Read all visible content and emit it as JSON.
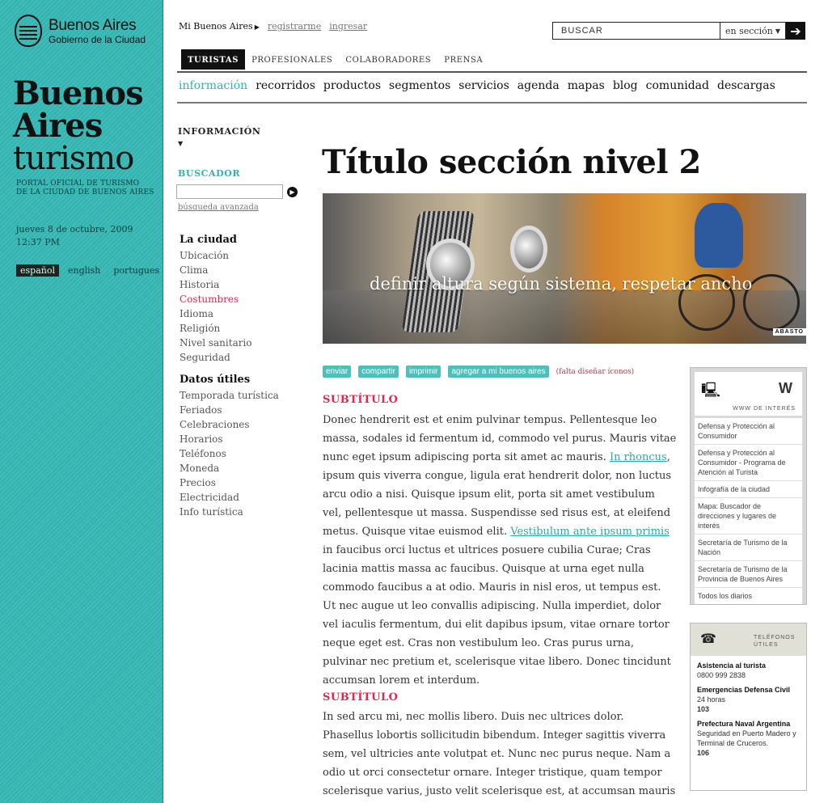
{
  "brand": {
    "logo_line1": "Buenos Aires",
    "logo_line2": "Gobierno de la Ciudad",
    "title_line1": "Buenos",
    "title_line2": "Aires",
    "title_line3": "turismo",
    "portal_line1": "PORTAL OFICIAL DE TURISMO",
    "portal_line2": "DE LA CIUDAD DE BUENOS AIRES",
    "date": "jueves 8 de octubre, 2009",
    "time": "12:37 PM",
    "accent_color": "#35b8b5"
  },
  "languages": [
    {
      "label": "español",
      "active": true
    },
    {
      "label": "english",
      "active": false
    },
    {
      "label": "portugues",
      "active": false
    }
  ],
  "topnav": {
    "mi": "Mi Buenos Aires",
    "register": "registrarme",
    "login": "ingresar"
  },
  "search": {
    "placeholder": "BUSCAR",
    "scope": "en sección",
    "go_icon": "arrow-right-icon"
  },
  "tabs": [
    "TURISTAS",
    "PROFESIONALES",
    "COLABORADORES",
    "PRENSA"
  ],
  "subnav": [
    "información",
    "recorridos",
    "productos",
    "segmentos",
    "servicios",
    "agenda",
    "mapas",
    "blog",
    "comunidad",
    "descargas"
  ],
  "sidebar": {
    "section": "INFORMACIÓN",
    "buscador_title": "BUSCADOR",
    "advanced": "búsqueda avanzada",
    "ciudad_title": "La ciudad",
    "ciudad": [
      "Ubicación",
      "Clima",
      "Historia",
      "Costumbres",
      "Idioma",
      "Religión",
      "Nivel sanitario",
      "Seguridad"
    ],
    "datos_title": "Datos útiles",
    "datos": [
      "Temporada turística",
      "Feriados",
      "Celebraciones",
      "Horarios",
      "Teléfonos",
      "Moneda",
      "Precios",
      "Electricidad",
      "Info turística"
    ]
  },
  "main": {
    "title": "Título sección nivel 2",
    "hero_caption": "definir altura según sistema, respetar ancho",
    "hero_credit": "ABASTO",
    "actions": [
      "enviar",
      "compartir",
      "imprimir",
      "agregar a mi buenos aires"
    ],
    "actions_note": "(falta diseñar íconos)",
    "subtitle1": "SUBTÍTULO",
    "p1_a": "Donec hendrerit est et enim pulvinar tempus. Pellentesque leo massa, sodales id fermentum id, commodo vel purus. Mauris vitae nunc eget ipsum adipiscing porta sit amet ac mauris. ",
    "p1_link1": "In rhoncus",
    "p1_b": ", ipsum quis viverra congue, ligula erat hendrerit dolor, non luctus arcu odio a nisi. Quisque ipsum elit, porta sit amet vestibulum vel, pellentesque ut massa. Suspendisse sed risus est, at eleifend metus. Quisque vitae euismod elit. ",
    "p1_link2": "Vestibulum ante ipsum primis",
    "p1_c": " in faucibus orci luctus et ultrices posuere cubilia Curae; Cras lacinia mattis massa ac faucibus. Quisque at urna eget nulla commodo faucibus a at odio. Mauris in nisl eros, ut tempus est. Ut nec augue ut leo convallis adipiscing. Nulla imperdiet, dolor vel iaculis fermentum, dui elit dapibus ipsum, vitae ornare tortor neque eget est. Cras non vestibulum leo. Cras purus urna, pulvinar nec pretium et, scelerisque vitae libero. Donec tincidunt accumsan lorem et interdum.",
    "subtitle2": "SUBTÍTULO",
    "p2": "In sed arcu mi, nec mollis libero. Duis nec ultrices dolor. Phasellus lobortis sollicitudin bibendum. Integer sagittis viverra sem, vel ultricies ante volutpat et. Nunc nec purus neque. Nam a odio ut orci consectetur ornare. Integer tristique, quam tempor scelerisque varius, justo velit scelerisque est, at accumsan mauris lectus eu tortor."
  },
  "www_box": {
    "letter": "W",
    "label": "WWW DE INTERÉS",
    "links": [
      "Defensa y Protección al Consumidor",
      "Defensa y Protección al Consumidor - Programa de Atención al Turista",
      "Infografía de la ciudad",
      "Mapa: Buscador de direcciones y lugares de interés",
      "Secretaría de Turismo de la Nación",
      "Secretaría de Turismo de la Provincia de Buenos Aires",
      "Todos los diarios"
    ]
  },
  "tel_box": {
    "label1": "TELÉFONOS",
    "label2": "ÚTILES",
    "items": [
      {
        "title": "Asistencia al turista",
        "line": "",
        "number": "0800 999 2838"
      },
      {
        "title": "Emergencias Defensa Civil",
        "line": "24 horas",
        "number": "103"
      },
      {
        "title": "Prefectura Naval Argentina",
        "line": "Seguridad en Puerto Madero y Terminal de Cruceros.",
        "number": "106"
      }
    ]
  }
}
